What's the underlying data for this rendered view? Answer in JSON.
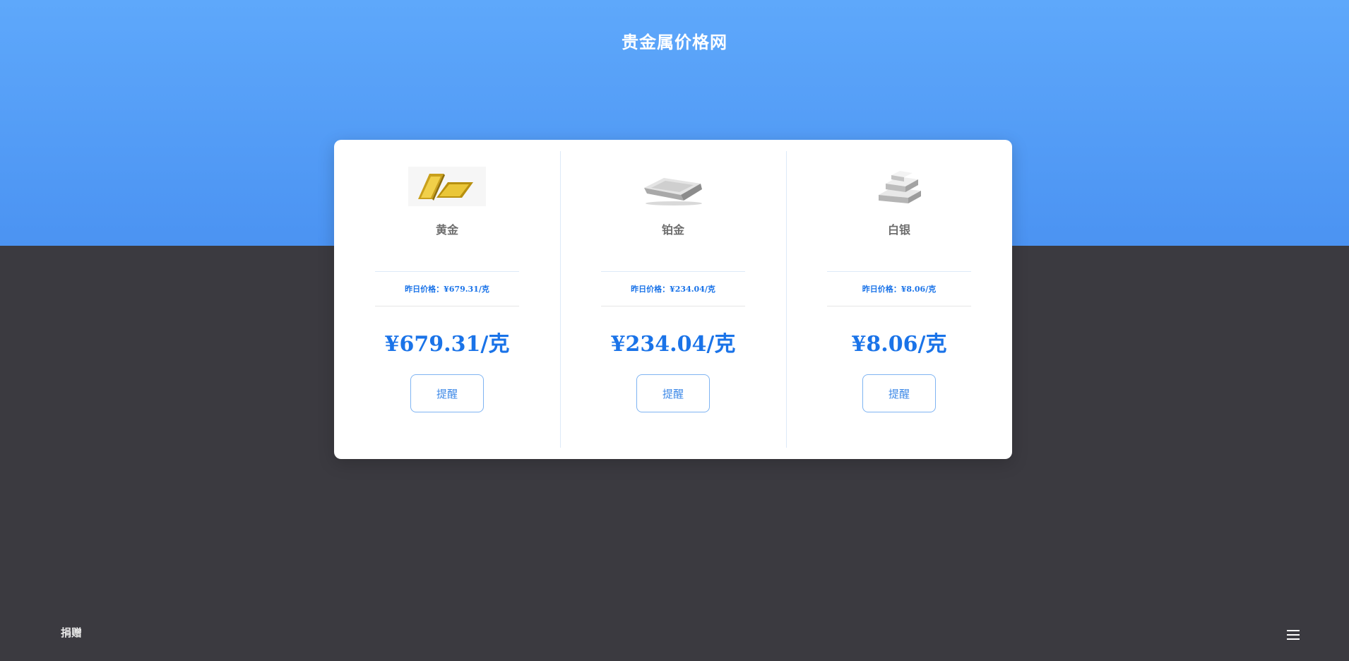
{
  "header": {
    "title": "贵金属价格网"
  },
  "metals": [
    {
      "name": "黄金",
      "icon": "gold-bar-icon",
      "yesterday": "昨日价格：¥679.31/克",
      "price": "¥679.31/克",
      "button": "提醒"
    },
    {
      "name": "铂金",
      "icon": "platinum-bar-icon",
      "yesterday": "昨日价格：¥234.04/克",
      "price": "¥234.04/克",
      "button": "提醒"
    },
    {
      "name": "白银",
      "icon": "silver-bars-icon",
      "yesterday": "昨日价格：¥8.06/克",
      "price": "¥8.06/克",
      "button": "提醒"
    }
  ],
  "footer": {
    "donate": "捐赠",
    "menu_icon": "hamburger-menu-icon"
  },
  "colors": {
    "accent": "#1a73e8",
    "hero": "#5ea8fb",
    "background": "#3b3a40"
  }
}
